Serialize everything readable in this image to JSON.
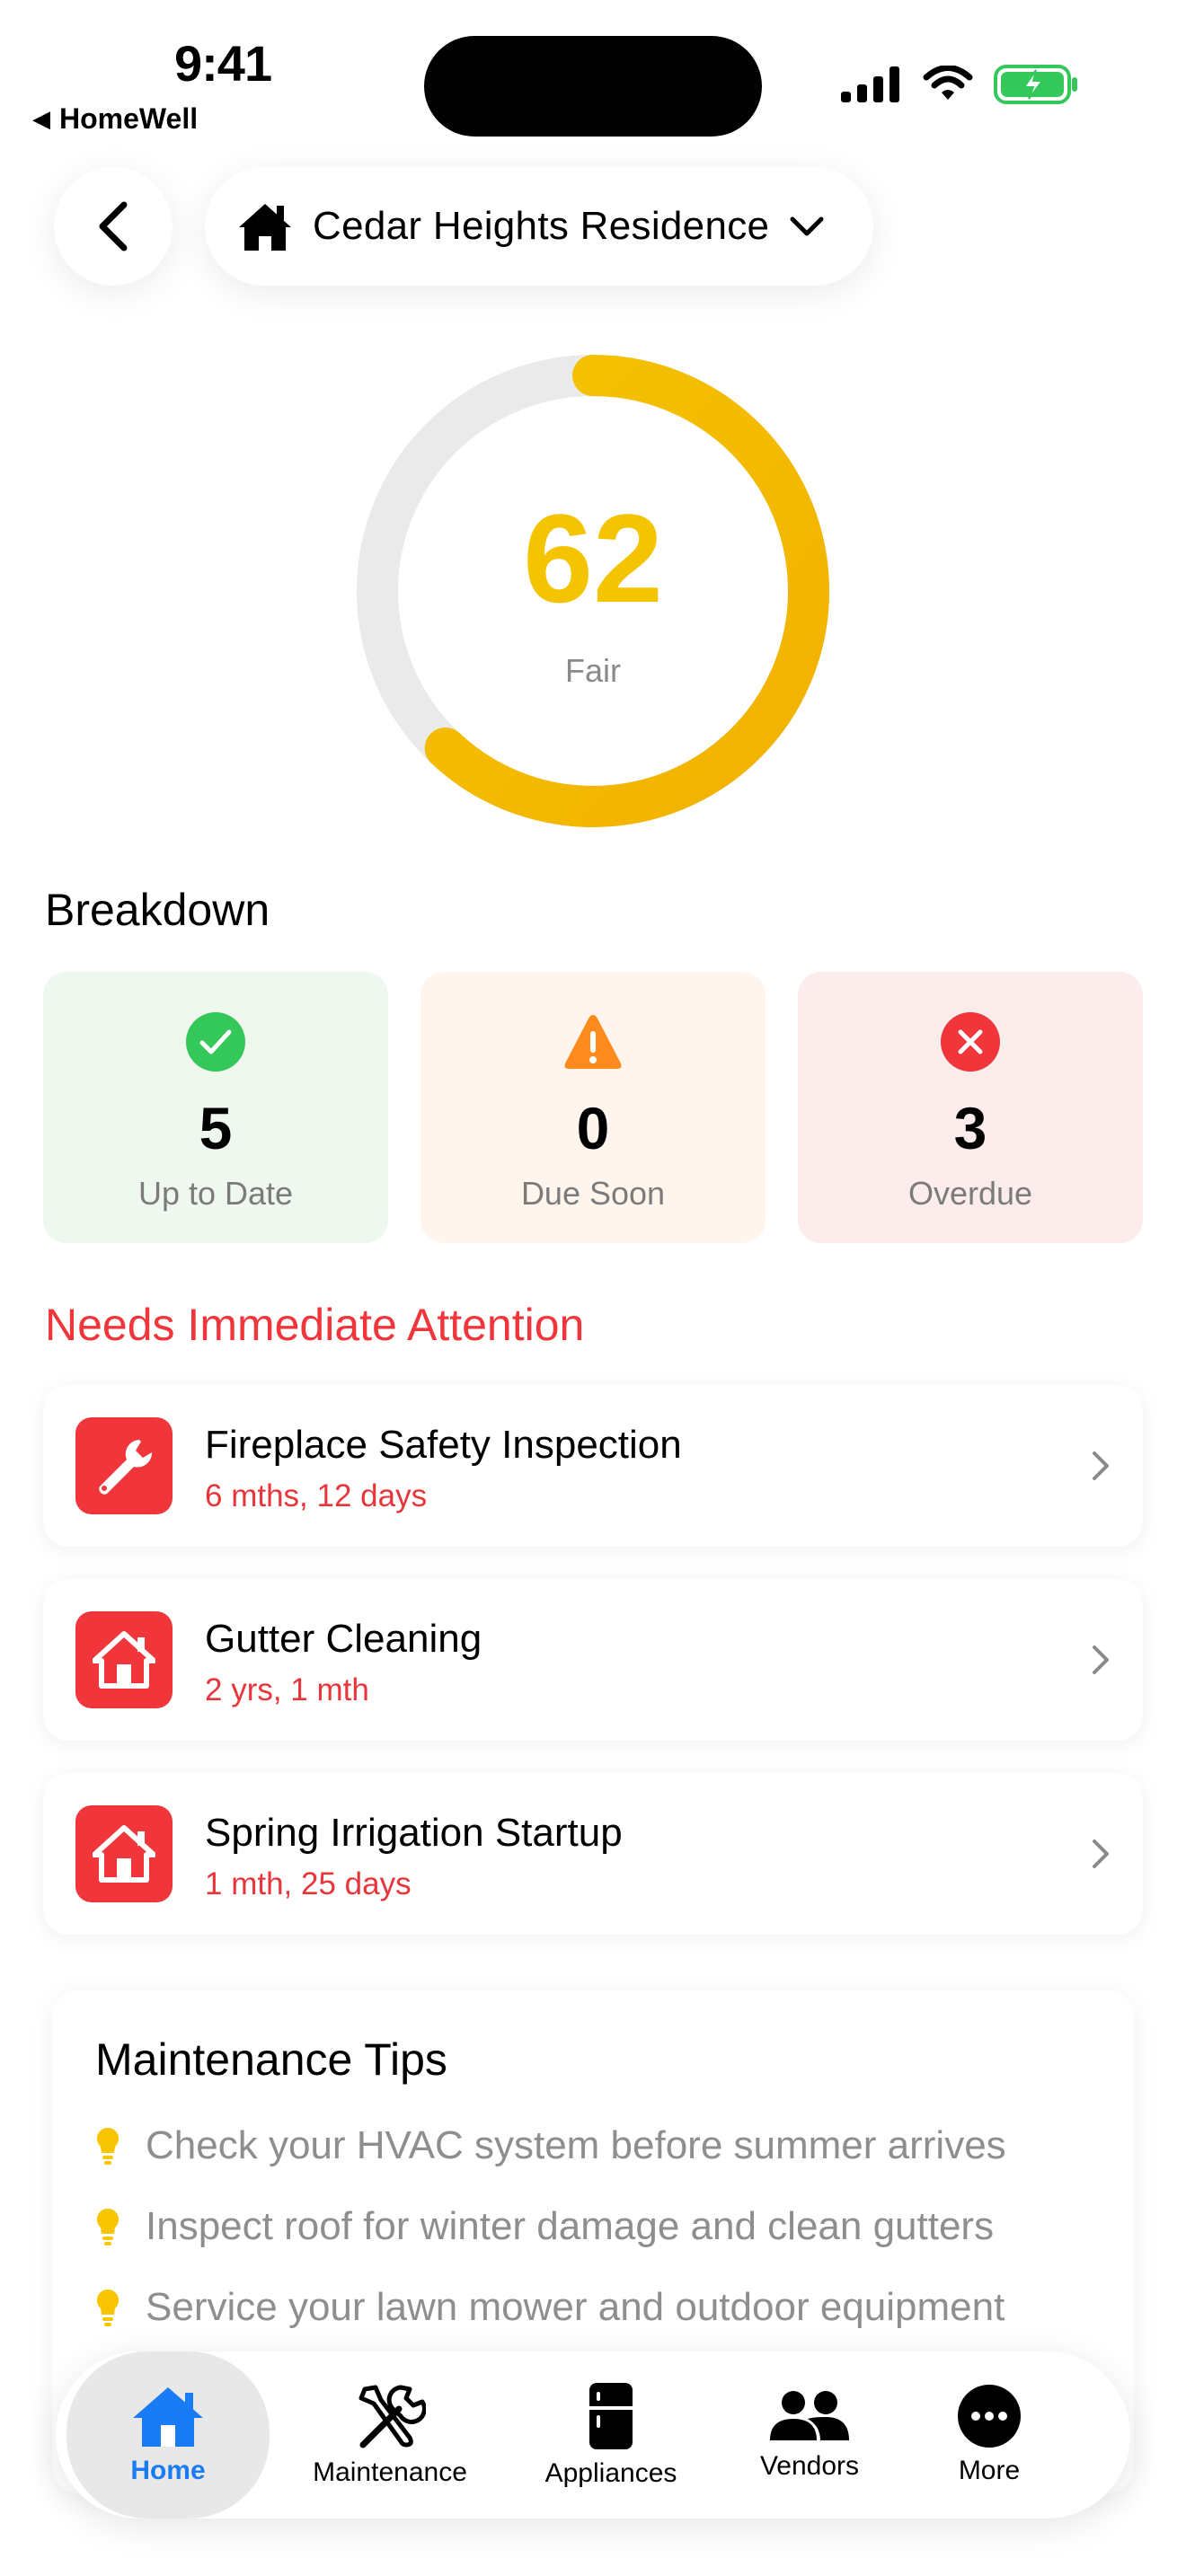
{
  "status_bar": {
    "time": "9:41",
    "back_app": "HomeWell"
  },
  "header": {
    "property_name": "Cedar Heights Residence"
  },
  "score": {
    "value": 62,
    "max": 100,
    "label": "Fair",
    "color": "#F5C400"
  },
  "breakdown": {
    "title": "Breakdown",
    "cards": [
      {
        "count": "5",
        "label": "Up to Date",
        "color": "#34C759"
      },
      {
        "count": "0",
        "label": "Due Soon",
        "color": "#FF8A1E"
      },
      {
        "count": "3",
        "label": "Overdue",
        "color": "#F0353B"
      }
    ]
  },
  "attention": {
    "title": "Needs Immediate Attention",
    "items": [
      {
        "name": "Fireplace Safety Inspection",
        "due": "6 mths, 12 days",
        "icon": "wrench-icon"
      },
      {
        "name": "Gutter Cleaning",
        "due": "2 yrs, 1 mth",
        "icon": "house-icon"
      },
      {
        "name": "Spring Irrigation Startup",
        "due": "1 mth, 25 days",
        "icon": "house-icon"
      }
    ]
  },
  "tips": {
    "title": "Maintenance Tips",
    "items": [
      "Check your HVAC system before summer arrives",
      "Inspect roof for winter damage and clean gutters",
      "Service your lawn mower and outdoor equipment"
    ]
  },
  "tabbar": {
    "tabs": [
      {
        "label": "Home",
        "icon": "house-icon",
        "active": true
      },
      {
        "label": "Maintenance",
        "icon": "tools-icon"
      },
      {
        "label": "Appliances",
        "icon": "fridge-icon"
      },
      {
        "label": "Vendors",
        "icon": "people-icon"
      },
      {
        "label": "More",
        "icon": "more-icon"
      }
    ],
    "accent": "#1A7CF4"
  }
}
